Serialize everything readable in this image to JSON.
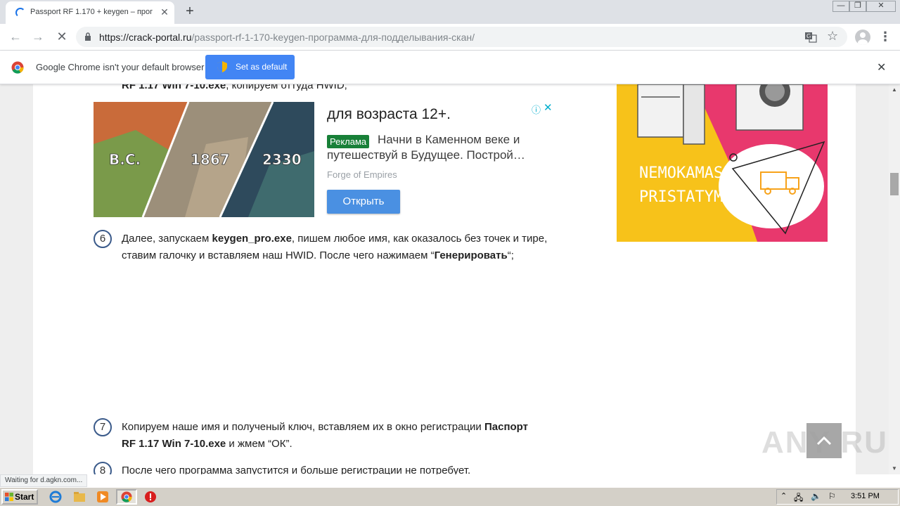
{
  "browser": {
    "tab_title": "Passport RF 1.170 + keygen – прог",
    "url_host": "https://crack-portal.ru",
    "url_path": "/passport-rf-1-170-keygen-программа-для-подделывания-скан/",
    "window_buttons": {
      "minimize": "—",
      "restore": "❐",
      "close": "✕"
    }
  },
  "infobar": {
    "message": "Google Chrome isn't your default browser",
    "set_default_label": "Set as default"
  },
  "article": {
    "partial_line_bold": "RF 1.17 Win 7-10.exe",
    "partial_line_rest": ", копируем оттуда HWID;",
    "steps": [
      {
        "num": "6",
        "text_before": "Далее, запускаем ",
        "bold1": "keygen_pro.exe",
        "text_mid": ", пишем любое имя, как оказалось без точек и тире, ставим галочку и вставляем наш HWID. После чего нажимаем “",
        "bold2": "Генерировать",
        "text_after": "“;"
      },
      {
        "num": "7",
        "text_before": "Копируем наше имя и полученый ключ, вставляем их в окно регистрации ",
        "bold1": "Паспорт RF 1.17 Win 7-10.exe",
        "text_after": " и жмем “ОК”."
      },
      {
        "num": "8",
        "text": "После чего программа запустится и больше регистрации не потребует."
      }
    ]
  },
  "ad": {
    "title": "для возраста 12+.",
    "badge": "Реклама",
    "description": "Начни в Каменном веке и путешествуй в Будущее. Построй…",
    "brand": "Forge of Empires",
    "open_label": "Открыть",
    "image_labels": [
      "B.C.",
      "1867",
      "2330"
    ]
  },
  "side_ad": {
    "line1": "NEMOKAMAS",
    "line2": "PRISTATYMAS"
  },
  "watermark": "ANY  RUN",
  "status_text": "Waiting for d.agkn.com...",
  "taskbar": {
    "start_label": "Start",
    "clock": "3:51 PM"
  },
  "colors": {
    "accent_blue": "#4285f4",
    "ad_button": "#4a90e2",
    "ad_badge": "#188038",
    "side_ad_yellow": "#f7c21a",
    "side_ad_pink": "#e8386d"
  }
}
